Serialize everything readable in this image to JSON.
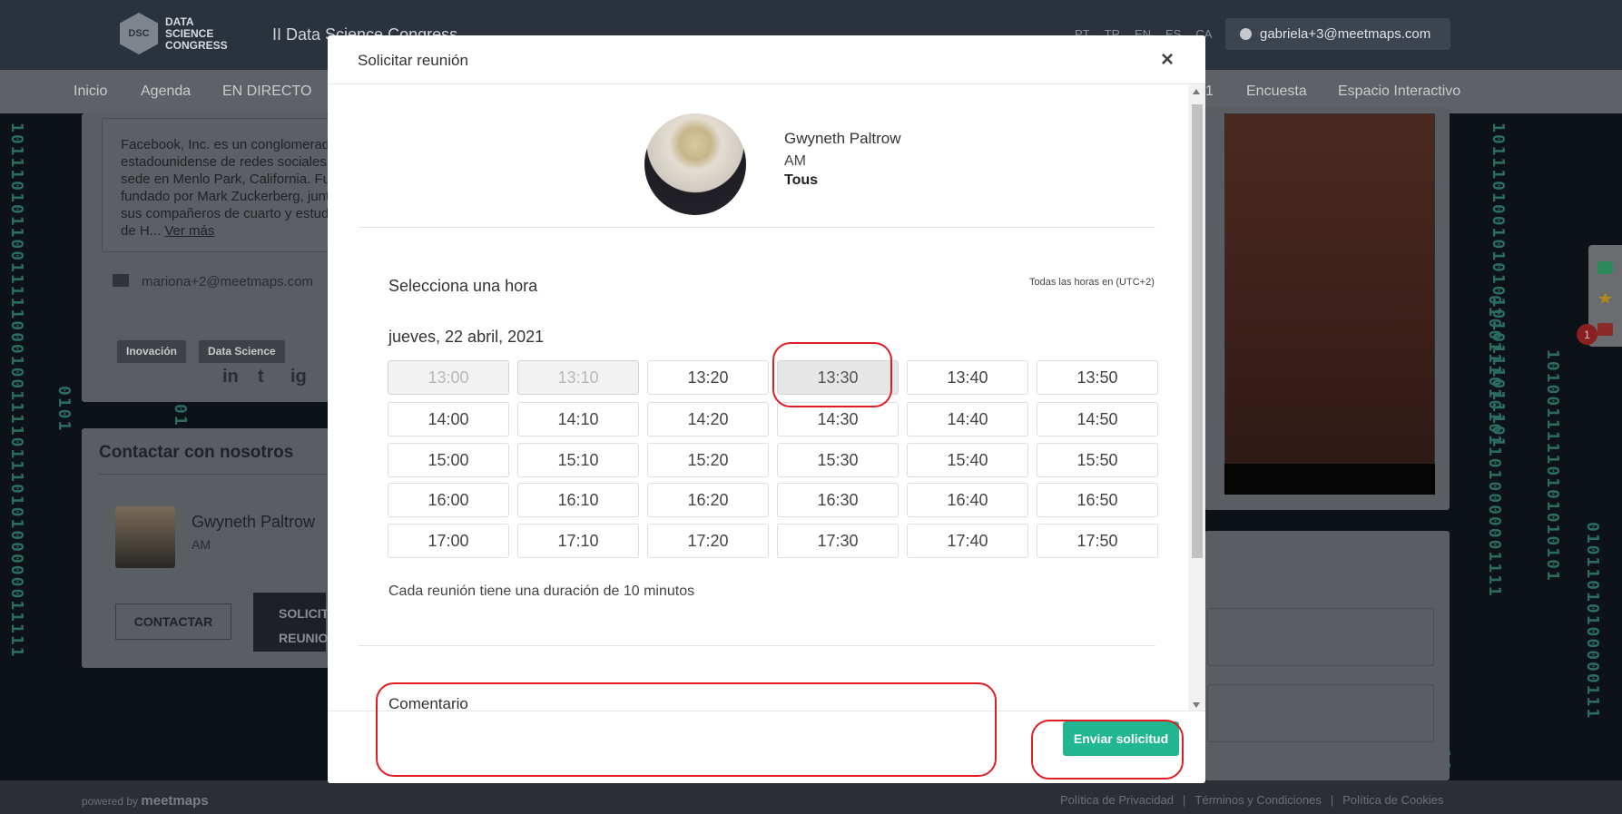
{
  "header": {
    "logo_abbr": "DSC",
    "logo_line1": "DATA",
    "logo_line2": "SCIENCE",
    "logo_line3": "CONGRESS",
    "event_title": "II Data Science Congress",
    "languages": [
      "PT",
      "TR",
      "EN",
      "ES",
      "CA"
    ],
    "user_email": "gabriela+3@meetmaps.com"
  },
  "nav": {
    "items": [
      "Inicio",
      "Agenda",
      "EN DIRECTO",
      "1",
      "Encuesta",
      "Espacio Interactivo"
    ]
  },
  "background": {
    "description_lines": [
      "Facebook, Inc. es un conglomerado",
      "estadounidense de redes sociales c",
      "sede en Menlo Park, California. Fue",
      "fundado por Mark Zuckerberg, junto",
      "sus compañeros de cuarto y estudi",
      "de H..."
    ],
    "see_more": "Ver más",
    "email": "mariona+2@meetmaps.com",
    "tags": [
      "Inovación",
      "Data Science"
    ],
    "social": [
      "in",
      "t",
      "ig"
    ],
    "contact_title": "Contactar con nosotros",
    "contact_name": "Gwyneth Paltrow",
    "contact_role": "AM",
    "contact_button": "CONTACTAR",
    "solicit_line1": "SOLICIT",
    "solicit_line2": "REUNIO",
    "notification_count": "1"
  },
  "modal": {
    "title": "Solicitar reunión",
    "close": "×",
    "profile": {
      "name": "Gwyneth Paltrow",
      "role": "AM",
      "company": "Tous"
    },
    "select_title": "Selecciona una hora",
    "timezone_note": "Todas las horas en (UTC+2)",
    "date": "jueves, 22 abril, 2021",
    "slots": [
      [
        "13:00",
        "13:10",
        "13:20",
        "13:30",
        "13:40",
        "13:50"
      ],
      [
        "14:00",
        "14:10",
        "14:20",
        "14:30",
        "14:40",
        "14:50"
      ],
      [
        "15:00",
        "15:10",
        "15:20",
        "15:30",
        "15:40",
        "15:50"
      ],
      [
        "16:00",
        "16:10",
        "16:20",
        "16:30",
        "16:40",
        "16:50"
      ],
      [
        "17:00",
        "17:10",
        "17:20",
        "17:30",
        "17:40",
        "17:50"
      ]
    ],
    "disabled_slots": [
      "13:00",
      "13:10"
    ],
    "selected_slot": "13:30",
    "duration_note": "Cada reunión tiene una duración de 10 minutos",
    "comment_label": "Comentario",
    "send_button": "Enviar solicitud"
  },
  "footer": {
    "powered_by": "powered by",
    "brand": "meetmaps",
    "links": [
      "Política de Privacidad",
      "|",
      "Términos y Condiciones",
      "|",
      "Política de Cookies"
    ]
  },
  "colors": {
    "accent": "#21b891",
    "highlight": "#e01c24",
    "header_bg": "#2a323d"
  }
}
